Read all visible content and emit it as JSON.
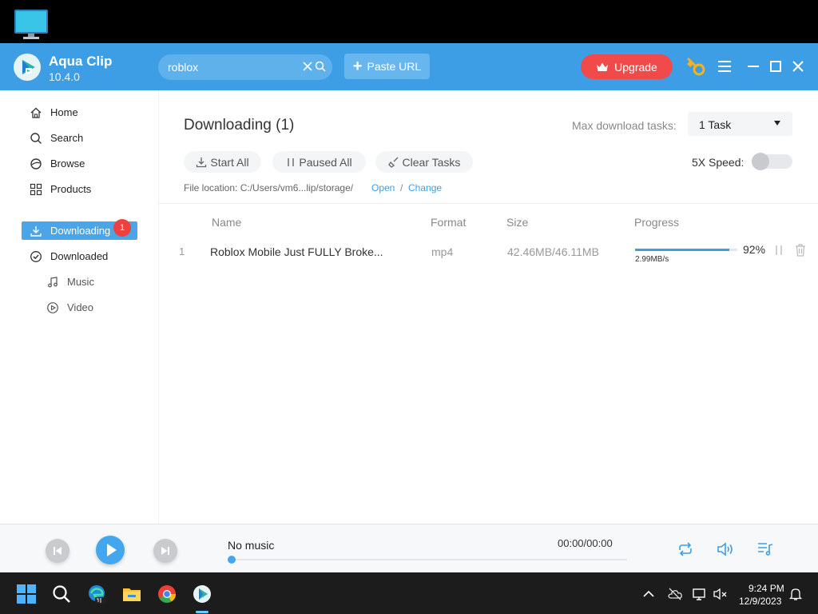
{
  "app": {
    "name": "Aqua Clip",
    "version": "10.4.0"
  },
  "header": {
    "search_value": "roblox",
    "paste_label": "Paste URL",
    "upgrade_label": "Upgrade"
  },
  "sidebar": {
    "items": [
      {
        "label": "Home",
        "icon": "home-icon"
      },
      {
        "label": "Search",
        "icon": "search-icon"
      },
      {
        "label": "Browse",
        "icon": "compass-icon"
      },
      {
        "label": "Products",
        "icon": "grid-icon"
      }
    ],
    "downloading": {
      "label": "Downloading",
      "badge": "1"
    },
    "downloaded": {
      "label": "Downloaded"
    },
    "sub_items": [
      {
        "label": "Music",
        "icon": "music-note-icon"
      },
      {
        "label": "Video",
        "icon": "play-circle-icon"
      }
    ]
  },
  "main": {
    "title": "Downloading (1)",
    "max_tasks_label": "Max download tasks:",
    "max_tasks_value": "1 Task",
    "buttons": {
      "start_all": "Start All",
      "paused_all": "Paused All",
      "clear_tasks": "Clear Tasks"
    },
    "speed_label": "5X Speed:",
    "speed_enabled": false,
    "file_location": "File location: C:/Users/vm6...lip/storage/",
    "open_label": "Open",
    "separator": "/",
    "change_label": "Change",
    "columns": {
      "name": "Name",
      "format": "Format",
      "size": "Size",
      "progress": "Progress"
    },
    "rows": [
      {
        "index": "1",
        "name": "Roblox Mobile Just FULLY Broke...",
        "format": "mp4",
        "size": "42.46MB/46.11MB",
        "progress_percent": 92,
        "progress_label": "92%",
        "speed": "2.99MB/s"
      }
    ]
  },
  "player": {
    "title": "No music",
    "time": "00:00/00:00"
  },
  "taskbar": {
    "time": "9:24 PM",
    "date": "12/9/2023"
  },
  "colors": {
    "accent": "#3e9ee5",
    "upgrade": "#f04a4a",
    "badge": "#ef4040"
  }
}
